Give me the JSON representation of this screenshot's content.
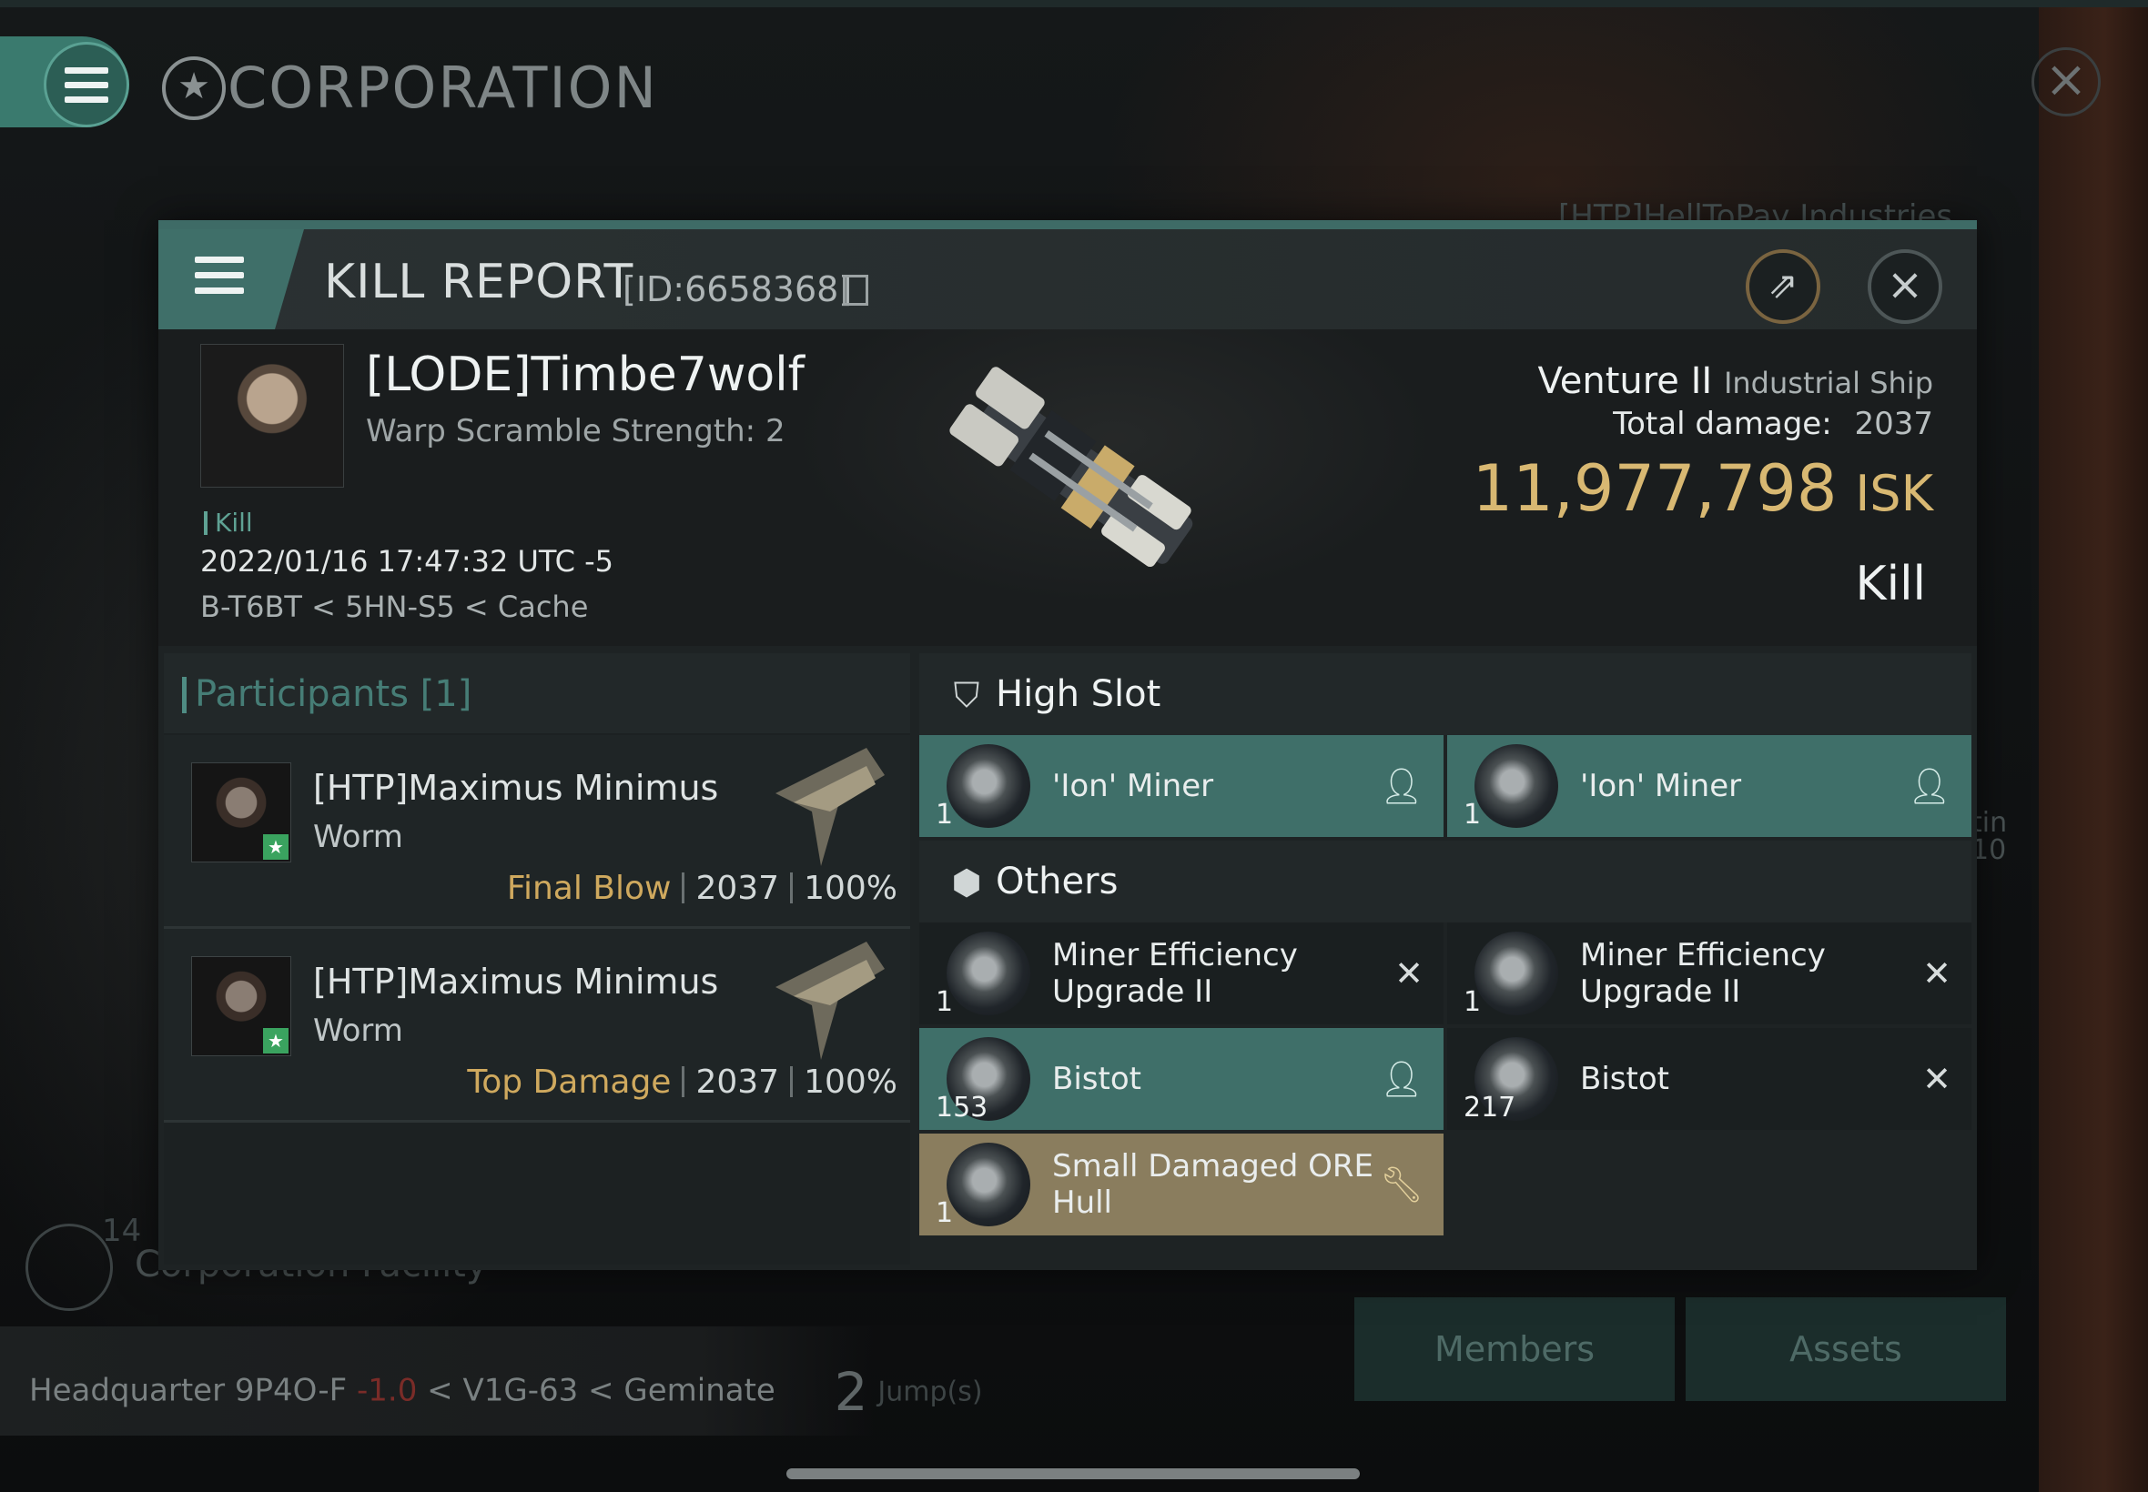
{
  "corporation": {
    "title": "CORPORATION"
  },
  "background": {
    "corp_name": "[HTP]HellToPay Industries",
    "facility_count": "14",
    "facility_label": "Corporation Facility",
    "hq_label": "Headquarter",
    "hq_system": "9P4O-F",
    "hq_security": "-1.0",
    "hq_constellation": "V1G-63",
    "hq_region": "Geminate",
    "jumps": "2",
    "jumps_label": "Jump(s)",
    "members_label": "Members",
    "assets_label": "Assets",
    "side_text_1": "tin",
    "side_text_2": "10"
  },
  "report": {
    "title": "KILL REPORT",
    "id_text": "[ID:6658368]"
  },
  "victim": {
    "name": "[LODE]Timbe7wolf",
    "warp_scramble": "Warp Scramble Strength: 2",
    "tag": "Kill",
    "datetime": "2022/01/16 17:47:32 UTC -5",
    "location": "B-T6BT < 5HN-S5 < Cache",
    "ship_name": "Venture II",
    "ship_class": "Industrial Ship",
    "total_damage_label": "Total damage:",
    "total_damage": "2037",
    "isk_value": "11,977,798",
    "isk_unit": "ISK",
    "report_type": "Kill"
  },
  "participants": {
    "header": "Participants [1]",
    "rows": [
      {
        "name": "[HTP]Maximus Minimus",
        "ship": "Worm",
        "label": "Final Blow",
        "damage": "2037",
        "percent": "100%"
      },
      {
        "name": "[HTP]Maximus Minimus",
        "ship": "Worm",
        "label": "Top Damage",
        "damage": "2037",
        "percent": "100%"
      }
    ]
  },
  "fitting": {
    "high_slot_label": "High Slot",
    "others_label": "Others",
    "high_slot": [
      {
        "qty": "1",
        "name": "'Ion' Miner",
        "state": "destroyed"
      },
      {
        "qty": "1",
        "name": "'Ion' Miner",
        "state": "destroyed"
      }
    ],
    "others": [
      {
        "qty": "1",
        "name": "Miner Efficiency Upgrade II",
        "state": "dropped"
      },
      {
        "qty": "1",
        "name": "Miner Efficiency Upgrade II",
        "state": "dropped"
      },
      {
        "qty": "153",
        "name": "Bistot",
        "state": "destroyed"
      },
      {
        "qty": "217",
        "name": "Bistot",
        "state": "dropped"
      },
      {
        "qty": "1",
        "name": "Small Damaged ORE Hull",
        "state": "salvage"
      }
    ]
  },
  "colors": {
    "teal": "#3f6f69",
    "gold": "#d8b872",
    "loot": "#8a7d5e",
    "final_blow": "#cfa95e"
  },
  "icons": [
    "menu-icon",
    "corporation-icon",
    "copy-icon",
    "share-icon",
    "close-icon",
    "pilot-icon",
    "x-icon",
    "wrench-icon",
    "shield-slot-icon",
    "cargo-box-icon"
  ]
}
